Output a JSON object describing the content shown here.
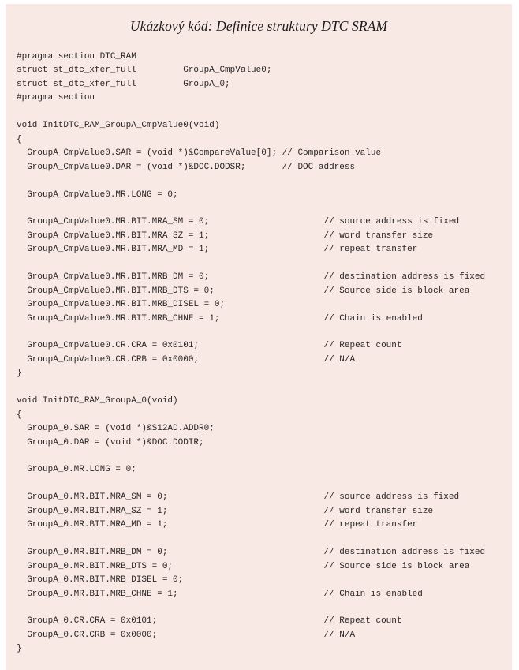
{
  "panel": {
    "title": "Ukázkový kód: Definice struktury DTC SRAM",
    "background_color": "#f8e9e4",
    "text_color": "#2a2526",
    "page_background_color": "#ffffff"
  },
  "code": {
    "language": "c",
    "comment_column": 58,
    "lines": [
      "#pragma section DTC_RAM",
      "struct st_dtc_xfer_full         GroupA_CmpValue0;",
      "struct st_dtc_xfer_full         GroupA_0;",
      "#pragma section",
      "",
      "void InitDTC_RAM_GroupA_CmpValue0(void)",
      "{",
      "  GroupA_CmpValue0.SAR = (void *)&CompareValue[0]; // Comparison value",
      "  GroupA_CmpValue0.DAR = (void *)&DOC.DODSR;       // DOC address",
      "",
      "  GroupA_CmpValue0.MR.LONG = 0;",
      "",
      "  GroupA_CmpValue0.MR.BIT.MRA_SM = 0;                      // source address is fixed",
      "  GroupA_CmpValue0.MR.BIT.MRA_SZ = 1;                      // word transfer size",
      "  GroupA_CmpValue0.MR.BIT.MRA_MD = 1;                      // repeat transfer",
      "",
      "  GroupA_CmpValue0.MR.BIT.MRB_DM = 0;                      // destination address is fixed",
      "  GroupA_CmpValue0.MR.BIT.MRB_DTS = 0;                     // Source side is block area",
      "  GroupA_CmpValue0.MR.BIT.MRB_DISEL = 0;",
      "  GroupA_CmpValue0.MR.BIT.MRB_CHNE = 1;                    // Chain is enabled",
      "",
      "  GroupA_CmpValue0.CR.CRA = 0x0101;                        // Repeat count",
      "  GroupA_CmpValue0.CR.CRB = 0x0000;                        // N/A",
      "}",
      "",
      "void InitDTC_RAM_GroupA_0(void)",
      "{",
      "  GroupA_0.SAR = (void *)&S12AD.ADDR0;",
      "  GroupA_0.DAR = (void *)&DOC.DODIR;",
      "",
      "  GroupA_0.MR.LONG = 0;",
      "",
      "  GroupA_0.MR.BIT.MRA_SM = 0;                              // source address is fixed",
      "  GroupA_0.MR.BIT.MRA_SZ = 1;                              // word transfer size",
      "  GroupA_0.MR.BIT.MRA_MD = 1;                              // repeat transfer",
      "",
      "  GroupA_0.MR.BIT.MRB_DM = 0;                              // destination address is fixed",
      "  GroupA_0.MR.BIT.MRB_DTS = 0;                             // Source side is block area",
      "  GroupA_0.MR.BIT.MRB_DISEL = 0;",
      "  GroupA_0.MR.BIT.MRB_CHNE = 1;                            // Chain is enabled",
      "",
      "  GroupA_0.CR.CRA = 0x0101;                                // Repeat count",
      "  GroupA_0.CR.CRB = 0x0000;                                // N/A",
      "}"
    ]
  }
}
